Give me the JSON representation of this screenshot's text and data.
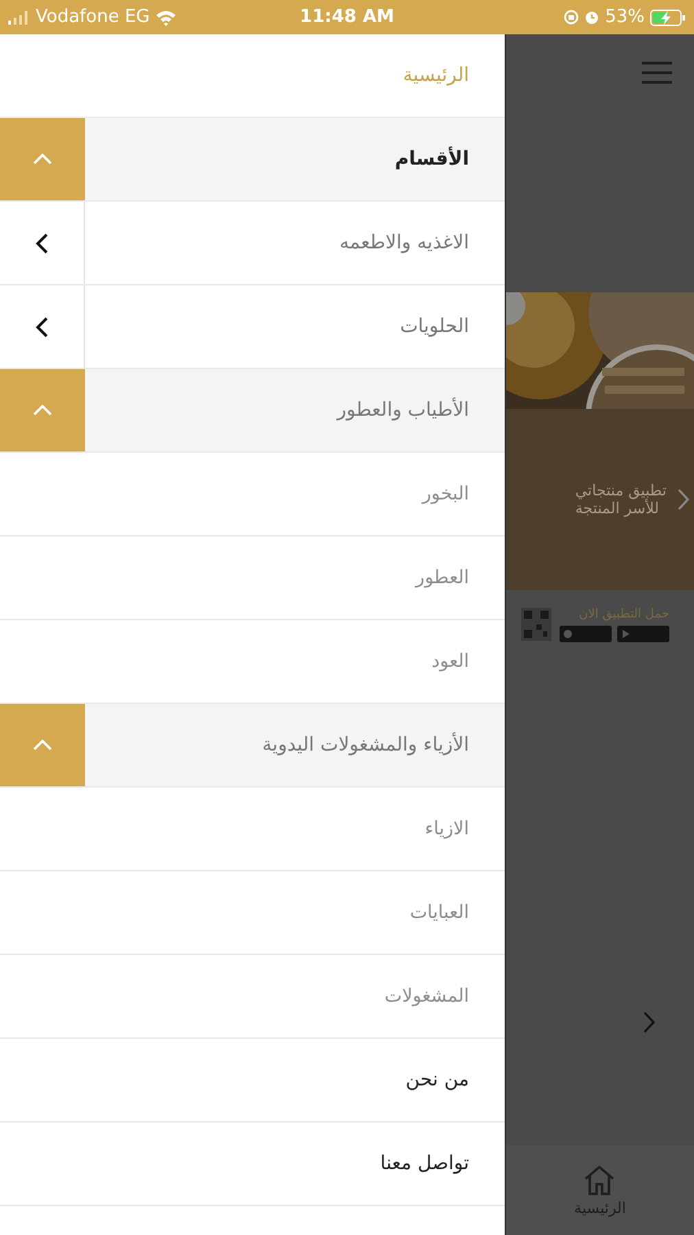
{
  "status_bar": {
    "carrier": "Vodafone EG",
    "time": "11:48 AM",
    "battery": "53%"
  },
  "drawer": {
    "title": "الرئيسية",
    "menu": [
      {
        "label": "الأقسام",
        "kind": "section",
        "expanded": true,
        "children": [
          {
            "label": "الاغذيه والاطعمه",
            "kind": "category",
            "expanded": false
          },
          {
            "label": "الحلويات",
            "kind": "category",
            "expanded": false
          },
          {
            "label": "الأطياب والعطور",
            "kind": "category",
            "expanded": true,
            "children": [
              {
                "label": "البخور",
                "kind": "leaf"
              },
              {
                "label": "العطور",
                "kind": "leaf"
              },
              {
                "label": "العود",
                "kind": "leaf"
              }
            ]
          },
          {
            "label": "الأزياء والمشغولات اليدوية",
            "kind": "category",
            "expanded": true,
            "children": [
              {
                "label": "الازياء",
                "kind": "leaf"
              },
              {
                "label": "العبايات",
                "kind": "leaf"
              },
              {
                "label": "المشغولات",
                "kind": "leaf"
              }
            ]
          }
        ]
      },
      {
        "label": "من نحن",
        "kind": "link"
      },
      {
        "label": "تواصل معنا",
        "kind": "link"
      }
    ]
  },
  "background_page": {
    "banner_lines": [
      "تطبيق منتجاتي",
      "للأسر المنتجة"
    ],
    "download_label": "حمل التطبيق الان",
    "tab_bar": [
      {
        "label": "الرئيسية"
      }
    ]
  }
}
